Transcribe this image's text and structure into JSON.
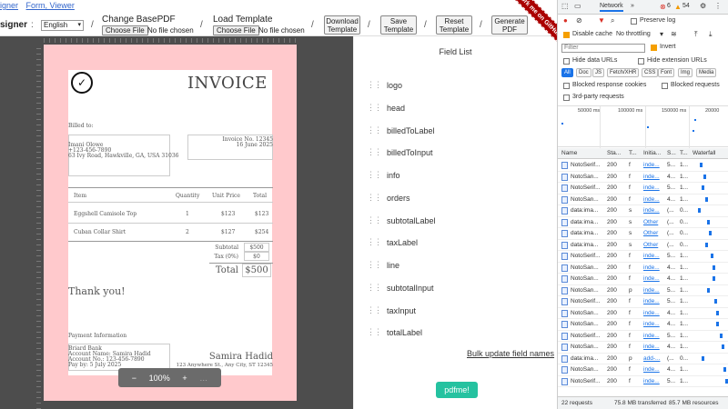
{
  "toolbar": {
    "nav_links": [
      "igner",
      "Form, Viewer"
    ],
    "brand": "signer",
    "lang_value": "English",
    "change_basepdf_label": "Change BasePDF",
    "load_template_label": "Load Template",
    "choose_file": "Choose File",
    "no_file": "No file chosen",
    "download_template": "Download Template",
    "save_template": "Save Template",
    "reset_template": "Reset Template",
    "generate_pdf": "Generate PDF"
  },
  "ribbon": "Fork me on GitHub",
  "invoice": {
    "title": "INVOICE",
    "billed_to_label": "Billed to:",
    "billed_to_name": "Imani Olowe",
    "billed_to_phone": "+123-456-7890",
    "billed_to_address": "63 Ivy Road, Hawkville, GA, USA 31036",
    "info_number": "Invoice No. 12345",
    "info_date": "16 June 2025",
    "col_item": "Item",
    "col_qty": "Quantity",
    "col_unit": "Unit Price",
    "col_total": "Total",
    "rows": [
      {
        "item": "Eggshell Camisole Top",
        "qty": "1",
        "unit": "$123",
        "total": "$123"
      },
      {
        "item": "Cuban Collar Shirt",
        "qty": "2",
        "unit": "$127",
        "total": "$254"
      }
    ],
    "subtotal_label": "Subtotal",
    "subtotal_value": "$500",
    "tax_label": "Tax (0%)",
    "tax_value": "$0",
    "total_label": "Total",
    "total_value": "$500",
    "thank_you": "Thank you!",
    "payment_label": "Payment Information",
    "payment_bank": "Briard Bank",
    "payment_account_name": "Account Name: Samira Hadid",
    "payment_account_no": "Account No.: 123-456-7890",
    "payment_pay_by": "Pay by: 5 July 2025",
    "shop_name": "Samira Hadid",
    "shop_address": "123 Anywhere St., Any City, ST 12345"
  },
  "zoom": {
    "minus": "−",
    "value": "100%",
    "plus": "+",
    "more": "…"
  },
  "fieldlist": {
    "title": "Field List",
    "items": [
      "logo",
      "head",
      "billedToLabel",
      "billedToInput",
      "info",
      "orders",
      "subtotalLabel",
      "taxLabel",
      "line",
      "subtotalInput",
      "taxInput",
      "totalLabel"
    ],
    "bulk_update": "Bulk update field names",
    "pdfme_button": "pdfme!"
  },
  "devtools": {
    "tab_network": "Network",
    "more_tabs": "»",
    "error_count": "6",
    "warning_count": "54",
    "preserve_log": "Preserve log",
    "disable_cache": "Disable cache",
    "throttling": "No throttling",
    "filter_placeholder": "Filter",
    "invert": "Invert",
    "hide_data_urls": "Hide data URLs",
    "hide_ext_urls": "Hide extension URLs",
    "types": [
      "All",
      "Doc",
      "JS",
      "Fetch/XHR",
      "CSS",
      "Font",
      "Img",
      "Media"
    ],
    "blocked_cookies": "Blocked response cookies",
    "blocked_requests": "Blocked requests",
    "third_party": "3rd-party requests",
    "timeline_labels": [
      "50000 ms",
      "100000 ms",
      "150000 ms",
      "20000"
    ],
    "col_name": "Name",
    "col_status": "Sta...",
    "col_type": "T...",
    "col_initiator": "Initia...",
    "col_size": "S...",
    "col_time": "T...",
    "col_waterfall": "Waterfall",
    "rows": [
      {
        "name": "NotoSerif...",
        "status": "200",
        "type": "f",
        "init": "inde...",
        "size": "5...",
        "time": "1..."
      },
      {
        "name": "NotoSan...",
        "status": "200",
        "type": "f",
        "init": "inde...",
        "size": "4...",
        "time": "1..."
      },
      {
        "name": "NotoSerif...",
        "status": "200",
        "type": "f",
        "init": "inde...",
        "size": "5...",
        "time": "1..."
      },
      {
        "name": "NotoSan...",
        "status": "200",
        "type": "f",
        "init": "inde...",
        "size": "4...",
        "time": "1..."
      },
      {
        "name": "data:ima...",
        "status": "200",
        "type": "s",
        "init": "inde...",
        "size": "(...",
        "time": "0..."
      },
      {
        "name": "data:ima...",
        "status": "200",
        "type": "s",
        "init": "Other",
        "size": "(...",
        "time": "0..."
      },
      {
        "name": "data:ima...",
        "status": "200",
        "type": "s",
        "init": "Other",
        "size": "(...",
        "time": "0..."
      },
      {
        "name": "data:ima...",
        "status": "200",
        "type": "s",
        "init": "Other",
        "size": "(...",
        "time": "0..."
      },
      {
        "name": "NotoSerif...",
        "status": "200",
        "type": "f",
        "init": "inde...",
        "size": "5...",
        "time": "1..."
      },
      {
        "name": "NotoSan...",
        "status": "200",
        "type": "f",
        "init": "inde...",
        "size": "4...",
        "time": "1..."
      },
      {
        "name": "NotoSan...",
        "status": "200",
        "type": "f",
        "init": "inde...",
        "size": "4...",
        "time": "1..."
      },
      {
        "name": "NotoSan...",
        "status": "200",
        "type": "p",
        "init": "inde...",
        "size": "5...",
        "time": "1..."
      },
      {
        "name": "NotoSerif...",
        "status": "200",
        "type": "f",
        "init": "inde...",
        "size": "5...",
        "time": "1..."
      },
      {
        "name": "NotoSan...",
        "status": "200",
        "type": "f",
        "init": "inde...",
        "size": "4...",
        "time": "1..."
      },
      {
        "name": "NotoSan...",
        "status": "200",
        "type": "f",
        "init": "inde...",
        "size": "4...",
        "time": "1..."
      },
      {
        "name": "NotoSerif...",
        "status": "200",
        "type": "f",
        "init": "inde...",
        "size": "5...",
        "time": "1..."
      },
      {
        "name": "NotoSan...",
        "status": "200",
        "type": "f",
        "init": "inde...",
        "size": "4...",
        "time": "1..."
      },
      {
        "name": "data:ima...",
        "status": "200",
        "type": "p",
        "init": "add-...",
        "size": "(...",
        "time": "0..."
      },
      {
        "name": "NotoSan...",
        "status": "200",
        "type": "f",
        "init": "inde...",
        "size": "4...",
        "time": "1..."
      },
      {
        "name": "NotoSerif...",
        "status": "200",
        "type": "f",
        "init": "inde...",
        "size": "5...",
        "time": "1..."
      },
      {
        "name": "NotoSan...",
        "status": "200",
        "type": "f",
        "init": "inde...",
        "size": "4...",
        "time": "1..."
      }
    ],
    "requests": "22 requests",
    "transferred": "75.8 MB transferred",
    "resources": "85.7 MB resources"
  }
}
